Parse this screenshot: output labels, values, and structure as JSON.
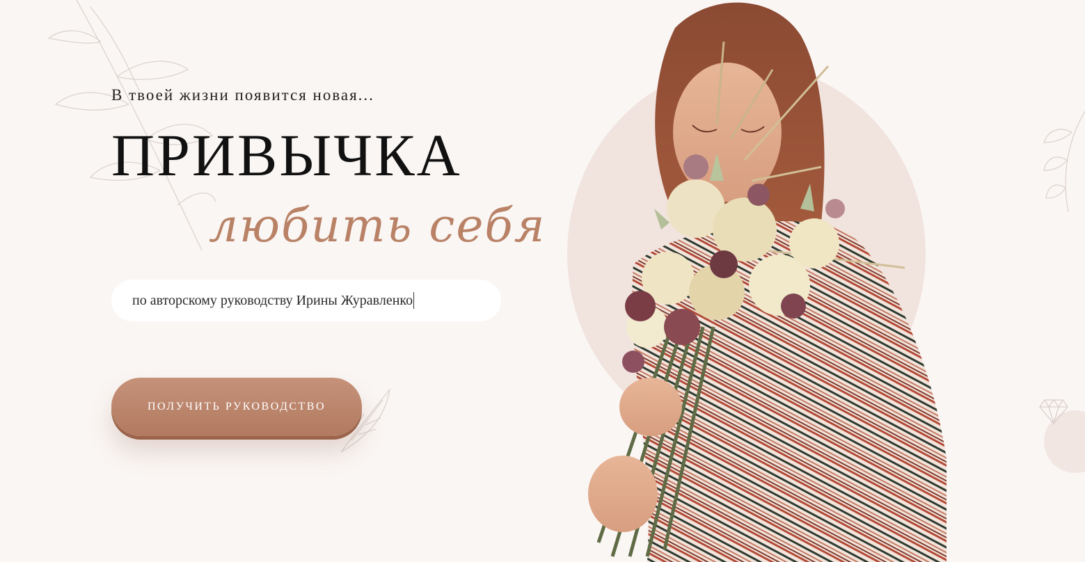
{
  "hero": {
    "pretitle": "В твоей жизни появится новая...",
    "title": "ПРИВЫЧКА",
    "subtitle": "любить себя",
    "tagline": "по авторскому руководству Ирины Журавленко",
    "cta_label": "ПОЛУЧИТЬ РУКОВОДСТВО"
  },
  "colors": {
    "background": "#faf6f4",
    "accent": "#b98266",
    "button": "#b9856a",
    "oval": "#f1e3de"
  },
  "icons": [
    "leaf-outline-icon",
    "diamond-outline-icon"
  ]
}
